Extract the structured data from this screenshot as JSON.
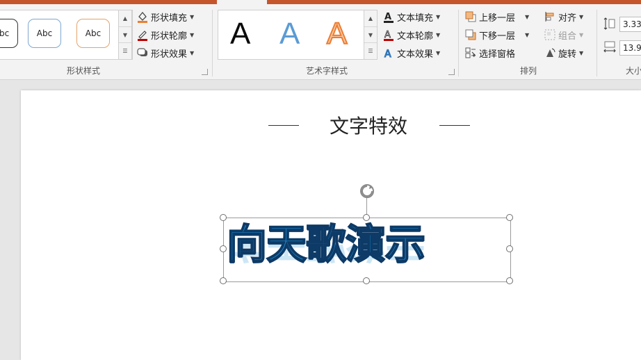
{
  "colors": {
    "accent": "#c5562b",
    "wordart_fill": "#1f8fd6",
    "wordart_outline": "#0d3a66"
  },
  "ribbon": {
    "shape_styles": {
      "label": "形状样式",
      "gallery": [
        "Abc",
        "Abc",
        "Abc"
      ],
      "commands": [
        {
          "label": "形状填充",
          "icon": "paint-bucket-icon"
        },
        {
          "label": "形状轮廓",
          "icon": "pen-outline-icon"
        },
        {
          "label": "形状效果",
          "icon": "shape-effects-icon"
        }
      ]
    },
    "wordart_styles": {
      "label": "艺术字样式",
      "gallery": [
        "A",
        "A",
        "A"
      ],
      "commands": [
        {
          "label": "文本填充",
          "icon": "text-fill-icon"
        },
        {
          "label": "文本轮廓",
          "icon": "text-outline-icon"
        },
        {
          "label": "文本效果",
          "icon": "text-effects-icon"
        }
      ]
    },
    "arrange": {
      "label": "排列",
      "commands": [
        {
          "label": "上移一层",
          "icon": "bring-forward-icon"
        },
        {
          "label": "下移一层",
          "icon": "send-backward-icon"
        },
        {
          "label": "选择窗格",
          "icon": "selection-pane-icon"
        },
        {
          "label": "对齐",
          "icon": "align-icon"
        },
        {
          "label": "组合",
          "icon": "group-icon"
        },
        {
          "label": "旋转",
          "icon": "rotate-icon"
        }
      ]
    },
    "size": {
      "label": "大小",
      "height_value": "3.33",
      "width_value": "13.9"
    }
  },
  "slide": {
    "title": "文字特效",
    "wordart_text": "向天歌演示"
  }
}
